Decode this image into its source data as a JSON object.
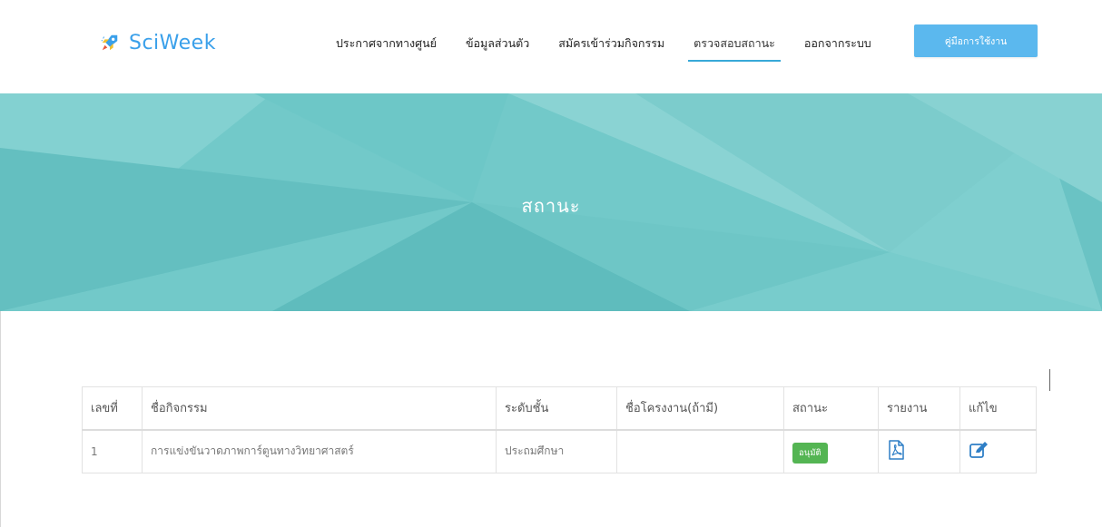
{
  "brand": {
    "name": "SciWeek",
    "icon": "rocket-icon"
  },
  "nav": {
    "items": [
      {
        "label": "ประกาศจากทางศูนย์",
        "active": false
      },
      {
        "label": "ข้อมูลส่วนตัว",
        "active": false
      },
      {
        "label": "สมัครเข้าร่วมกิจกรรม",
        "active": false
      },
      {
        "label": "ตรวจสอบสถานะ",
        "active": true
      },
      {
        "label": "ออกจากระบบ",
        "active": false
      }
    ],
    "manual_button": "คู่มือการใช้งาน"
  },
  "hero": {
    "title": "สถานะ"
  },
  "colors": {
    "brand": "#3aa0ea",
    "hero": "#6cc8c8",
    "button": "#5bb8ee",
    "badge_approved": "#54b553",
    "icon": "#2f7fc6"
  },
  "table": {
    "headers": [
      "เลขที่",
      "ชื่อกิจกรรม",
      "ระดับชั้น",
      "ชื่อโครงงาน(ถ้ามี)",
      "สถานะ",
      "รายงาน",
      "แก้ไข"
    ],
    "rows": [
      {
        "no": "1",
        "activity": "การแข่งขันวาดภาพการ์ตูนทางวิทยาศาสตร์",
        "level": "ประถมศึกษา",
        "project": "",
        "status": "อนุมัติ",
        "report_icon": "pdf-file-icon",
        "edit_icon": "edit-icon"
      }
    ]
  }
}
